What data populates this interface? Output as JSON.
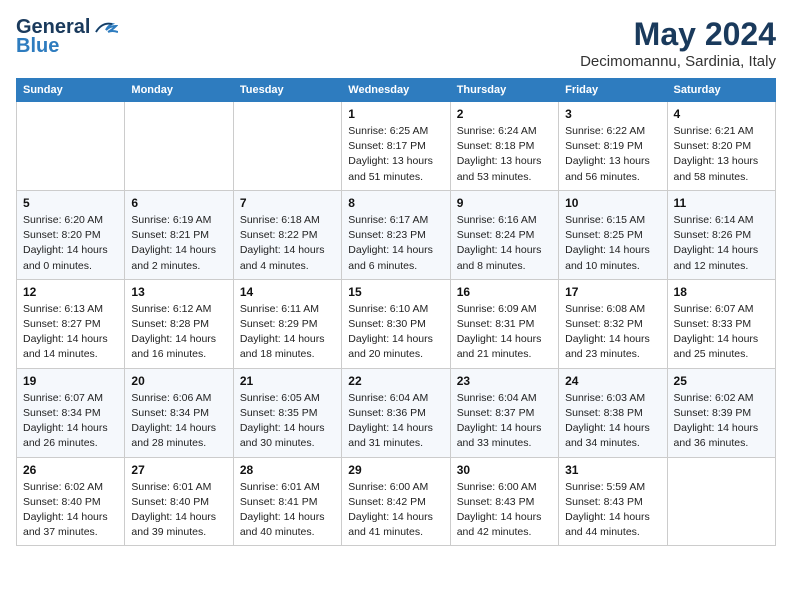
{
  "header": {
    "logo_line1": "General",
    "logo_line2": "Blue",
    "month": "May 2024",
    "location": "Decimomannu, Sardinia, Italy"
  },
  "weekdays": [
    "Sunday",
    "Monday",
    "Tuesday",
    "Wednesday",
    "Thursday",
    "Friday",
    "Saturday"
  ],
  "weeks": [
    [
      {
        "day": "",
        "info": ""
      },
      {
        "day": "",
        "info": ""
      },
      {
        "day": "",
        "info": ""
      },
      {
        "day": "1",
        "info": "Sunrise: 6:25 AM\nSunset: 8:17 PM\nDaylight: 13 hours\nand 51 minutes."
      },
      {
        "day": "2",
        "info": "Sunrise: 6:24 AM\nSunset: 8:18 PM\nDaylight: 13 hours\nand 53 minutes."
      },
      {
        "day": "3",
        "info": "Sunrise: 6:22 AM\nSunset: 8:19 PM\nDaylight: 13 hours\nand 56 minutes."
      },
      {
        "day": "4",
        "info": "Sunrise: 6:21 AM\nSunset: 8:20 PM\nDaylight: 13 hours\nand 58 minutes."
      }
    ],
    [
      {
        "day": "5",
        "info": "Sunrise: 6:20 AM\nSunset: 8:20 PM\nDaylight: 14 hours\nand 0 minutes."
      },
      {
        "day": "6",
        "info": "Sunrise: 6:19 AM\nSunset: 8:21 PM\nDaylight: 14 hours\nand 2 minutes."
      },
      {
        "day": "7",
        "info": "Sunrise: 6:18 AM\nSunset: 8:22 PM\nDaylight: 14 hours\nand 4 minutes."
      },
      {
        "day": "8",
        "info": "Sunrise: 6:17 AM\nSunset: 8:23 PM\nDaylight: 14 hours\nand 6 minutes."
      },
      {
        "day": "9",
        "info": "Sunrise: 6:16 AM\nSunset: 8:24 PM\nDaylight: 14 hours\nand 8 minutes."
      },
      {
        "day": "10",
        "info": "Sunrise: 6:15 AM\nSunset: 8:25 PM\nDaylight: 14 hours\nand 10 minutes."
      },
      {
        "day": "11",
        "info": "Sunrise: 6:14 AM\nSunset: 8:26 PM\nDaylight: 14 hours\nand 12 minutes."
      }
    ],
    [
      {
        "day": "12",
        "info": "Sunrise: 6:13 AM\nSunset: 8:27 PM\nDaylight: 14 hours\nand 14 minutes."
      },
      {
        "day": "13",
        "info": "Sunrise: 6:12 AM\nSunset: 8:28 PM\nDaylight: 14 hours\nand 16 minutes."
      },
      {
        "day": "14",
        "info": "Sunrise: 6:11 AM\nSunset: 8:29 PM\nDaylight: 14 hours\nand 18 minutes."
      },
      {
        "day": "15",
        "info": "Sunrise: 6:10 AM\nSunset: 8:30 PM\nDaylight: 14 hours\nand 20 minutes."
      },
      {
        "day": "16",
        "info": "Sunrise: 6:09 AM\nSunset: 8:31 PM\nDaylight: 14 hours\nand 21 minutes."
      },
      {
        "day": "17",
        "info": "Sunrise: 6:08 AM\nSunset: 8:32 PM\nDaylight: 14 hours\nand 23 minutes."
      },
      {
        "day": "18",
        "info": "Sunrise: 6:07 AM\nSunset: 8:33 PM\nDaylight: 14 hours\nand 25 minutes."
      }
    ],
    [
      {
        "day": "19",
        "info": "Sunrise: 6:07 AM\nSunset: 8:34 PM\nDaylight: 14 hours\nand 26 minutes."
      },
      {
        "day": "20",
        "info": "Sunrise: 6:06 AM\nSunset: 8:34 PM\nDaylight: 14 hours\nand 28 minutes."
      },
      {
        "day": "21",
        "info": "Sunrise: 6:05 AM\nSunset: 8:35 PM\nDaylight: 14 hours\nand 30 minutes."
      },
      {
        "day": "22",
        "info": "Sunrise: 6:04 AM\nSunset: 8:36 PM\nDaylight: 14 hours\nand 31 minutes."
      },
      {
        "day": "23",
        "info": "Sunrise: 6:04 AM\nSunset: 8:37 PM\nDaylight: 14 hours\nand 33 minutes."
      },
      {
        "day": "24",
        "info": "Sunrise: 6:03 AM\nSunset: 8:38 PM\nDaylight: 14 hours\nand 34 minutes."
      },
      {
        "day": "25",
        "info": "Sunrise: 6:02 AM\nSunset: 8:39 PM\nDaylight: 14 hours\nand 36 minutes."
      }
    ],
    [
      {
        "day": "26",
        "info": "Sunrise: 6:02 AM\nSunset: 8:40 PM\nDaylight: 14 hours\nand 37 minutes."
      },
      {
        "day": "27",
        "info": "Sunrise: 6:01 AM\nSunset: 8:40 PM\nDaylight: 14 hours\nand 39 minutes."
      },
      {
        "day": "28",
        "info": "Sunrise: 6:01 AM\nSunset: 8:41 PM\nDaylight: 14 hours\nand 40 minutes."
      },
      {
        "day": "29",
        "info": "Sunrise: 6:00 AM\nSunset: 8:42 PM\nDaylight: 14 hours\nand 41 minutes."
      },
      {
        "day": "30",
        "info": "Sunrise: 6:00 AM\nSunset: 8:43 PM\nDaylight: 14 hours\nand 42 minutes."
      },
      {
        "day": "31",
        "info": "Sunrise: 5:59 AM\nSunset: 8:43 PM\nDaylight: 14 hours\nand 44 minutes."
      },
      {
        "day": "",
        "info": ""
      }
    ]
  ]
}
